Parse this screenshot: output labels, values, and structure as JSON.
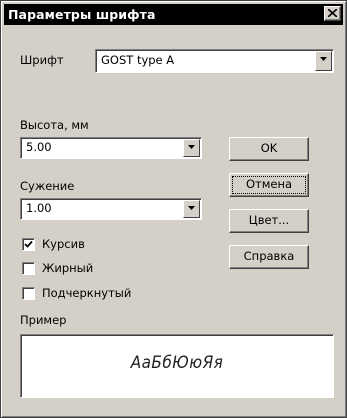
{
  "window": {
    "title": "Параметры шрифта"
  },
  "font": {
    "label": "Шрифт",
    "value": "GOST type A"
  },
  "height": {
    "label": "Высота, мм",
    "value": "5.00"
  },
  "narrowing": {
    "label": "Сужение",
    "value": "1.00"
  },
  "buttons": {
    "ok": "OK",
    "cancel": "Отмена",
    "color": "Цвет...",
    "help": "Справка"
  },
  "style": {
    "italic": {
      "label": "Курсив",
      "checked": true
    },
    "bold": {
      "label": "Жирный",
      "checked": false
    },
    "underline": {
      "label": "Подчеркнутый",
      "checked": false
    }
  },
  "preview": {
    "label": "Пример",
    "sample": "АаБбЮюЯя"
  }
}
